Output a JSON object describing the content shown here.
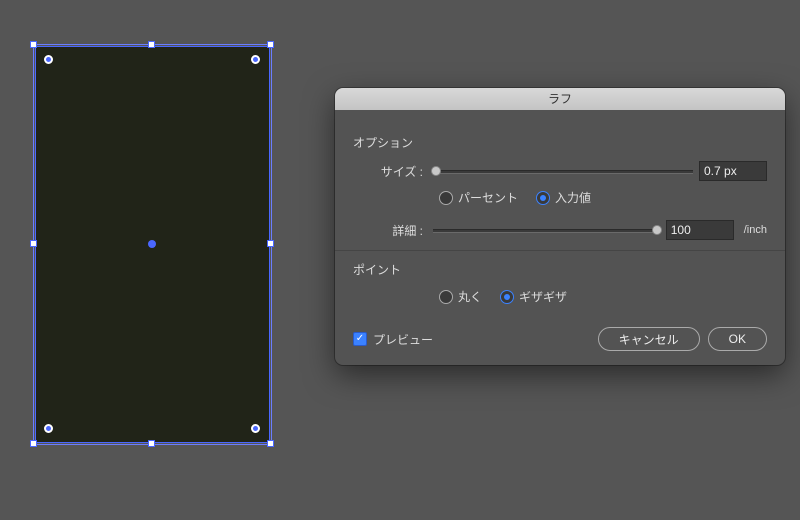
{
  "dialog": {
    "title": "ラフ",
    "options_label": "オプション",
    "size_label": "サイズ :",
    "size_value": "0.7 px",
    "size_mode_percent": "パーセント",
    "size_mode_absolute": "入力値",
    "size_mode_selected": "absolute",
    "detail_label": "詳細 :",
    "detail_value": "100",
    "detail_unit": "/inch",
    "points_label": "ポイント",
    "points_round": "丸く",
    "points_jagged": "ギザギザ",
    "points_selected": "jagged",
    "preview_label": "プレビュー",
    "preview_checked": true,
    "cancel": "キャンセル",
    "ok": "OK"
  }
}
